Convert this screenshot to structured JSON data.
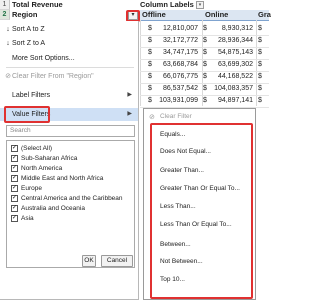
{
  "sheet": {
    "row_numbers": [
      "1",
      "2"
    ],
    "title": "Total Revenue",
    "region_header": "Region",
    "column_labels": "Column Labels",
    "headers": [
      "Offline",
      "Online",
      "Gra"
    ],
    "currency": "$",
    "rows": [
      {
        "offline": "12,810,007",
        "online": "8,930,312"
      },
      {
        "offline": "32,172,772",
        "online": "28,936,344"
      },
      {
        "offline": "34,747,175",
        "online": "54,875,143"
      },
      {
        "offline": "63,668,784",
        "online": "63,699,302"
      },
      {
        "offline": "66,076,775",
        "online": "44,168,522"
      },
      {
        "offline": "86,537,542",
        "online": "104,083,357"
      },
      {
        "offline": "103,931,099",
        "online": "94,897,141"
      }
    ]
  },
  "menu": {
    "sort_az": "Sort A to Z",
    "sort_za": "Sort Z to A",
    "more_sort": "More Sort Options...",
    "clear_filter": "Clear Filter From \"Region\"",
    "label_filters": "Label Filters",
    "value_filters": "Value Filters",
    "search_placeholder": "Search",
    "items": [
      {
        "label": "(Select All)",
        "checked": true
      },
      {
        "label": "Sub-Saharan Africa",
        "checked": true
      },
      {
        "label": "North America",
        "checked": true
      },
      {
        "label": "Middle East and North Africa",
        "checked": true
      },
      {
        "label": "Europe",
        "checked": true
      },
      {
        "label": "Central America and the Caribbean",
        "checked": true
      },
      {
        "label": "Australia and Oceania",
        "checked": true
      },
      {
        "label": "Asia",
        "checked": true
      }
    ],
    "ok": "OK",
    "cancel": "Cancel"
  },
  "submenu": {
    "clear_filter": "Clear Filter",
    "items": [
      "Equals...",
      "Does Not Equal...",
      "Greater Than...",
      "Greater Than Or Equal To...",
      "Less Than...",
      "Less Than Or Equal To...",
      "Between...",
      "Not Between...",
      "Top 10..."
    ]
  },
  "colors": {
    "highlight_red": "#e03131",
    "selected_blue": "#cfe0f5",
    "header_band": "#dce6f2"
  }
}
